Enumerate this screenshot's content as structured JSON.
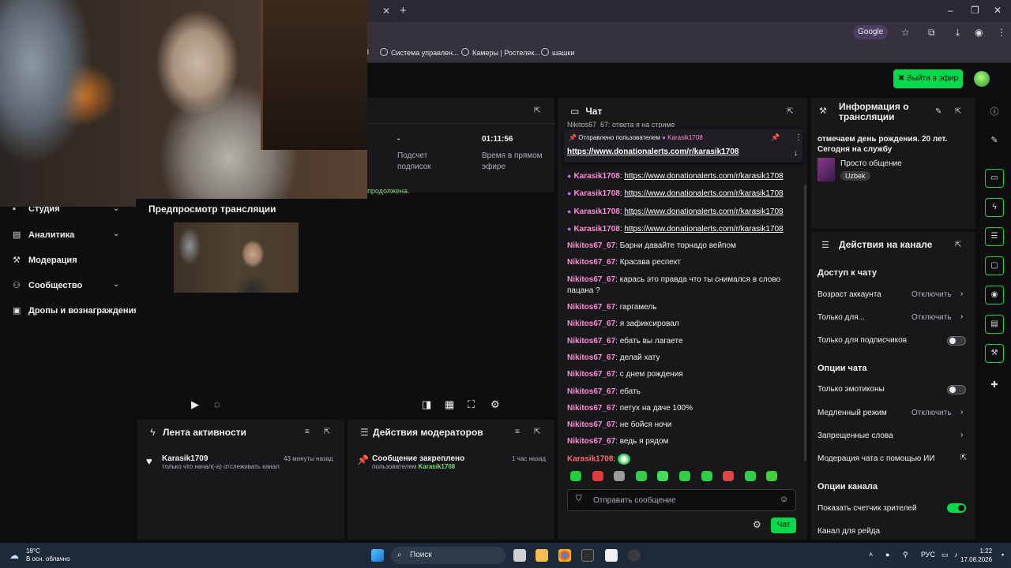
{
  "browser": {
    "bookmarks": [
      "8",
      "Система управлен...",
      "Камеры | Ростелек...",
      "шашки"
    ],
    "google_chip": "Google"
  },
  "topbar": {
    "go_live": "Выйти в эфир"
  },
  "leftnav": {
    "items": [
      {
        "label": "Студия",
        "icon": "camera-icon",
        "has_chevron": true
      },
      {
        "label": "Аналитика",
        "icon": "chart-icon",
        "has_chevron": true
      },
      {
        "label": "Модерация",
        "icon": "wrench-icon",
        "has_chevron": false
      },
      {
        "label": "Сообщество",
        "icon": "people-icon",
        "has_chevron": true
      },
      {
        "label": "Дропы и вознаграждения",
        "icon": "gift-icon",
        "has_chevron": false
      }
    ]
  },
  "stats": {
    "subs_value": "-",
    "subs_label": "Подсчет подписок",
    "uptime_value": "01:11:56",
    "uptime_label": "Время в прямом эфире",
    "note": "продолжена."
  },
  "preview": {
    "title": "Предпросмотр трансляции"
  },
  "activity": {
    "title": "Лента активности",
    "events": [
      {
        "name": "Karasik1709",
        "sub": "только что начал(-а) отслеживать канал",
        "time": "43 минуты назад"
      }
    ]
  },
  "mod_actions": {
    "title": "Действия модераторов",
    "events": [
      {
        "name": "Сообщение закреплено",
        "sub_prefix": "пользователем",
        "sub_user": "Karasik1708",
        "time": "1 час назад"
      }
    ]
  },
  "chat": {
    "title": "Чат",
    "cut_top": "Nikitos67_67: ответа я на стриме",
    "pinned_by_label": "Отправлено пользователем",
    "pinned_by_user": "Karasik1708",
    "pinned_link": "https://www.donationalerts.com/r/karasik1708",
    "messages": [
      {
        "user": "Karasik1708",
        "text": "https://www.donationalerts.com/r/karasik1708",
        "link": true,
        "mic": true
      },
      {
        "user": "Karasik1708",
        "text": "https://www.donationalerts.com/r/karasik1708",
        "link": true,
        "mic": true
      },
      {
        "user": "Karasik1708",
        "text": "https://www.donationalerts.com/r/karasik1708",
        "link": true,
        "mic": true
      },
      {
        "user": "Karasik1708",
        "text": "https://www.donationalerts.com/r/karasik1708",
        "link": true,
        "mic": true
      },
      {
        "user": "Nikitos67_67",
        "text": "Барни давайте торнадо вейпом"
      },
      {
        "user": "Nikitos67_67",
        "text": "Красава респект"
      },
      {
        "user": "Nikitos67_67",
        "text": "карась это правда что ты снимался в слово пацана ?"
      },
      {
        "user": "Nikitos67_67",
        "text": "гаргамель"
      },
      {
        "user": "Nikitos67_67",
        "text": "я зафиксировал"
      },
      {
        "user": "Nikitos67_67",
        "text": "ебать вы лагаете"
      },
      {
        "user": "Nikitos67_67",
        "text": "делай хату"
      },
      {
        "user": "Nikitos67_67",
        "text": "с днем рождения"
      },
      {
        "user": "Nikitos67_67",
        "text": "ебать"
      },
      {
        "user": "Nikitos67_67",
        "text": "петух на даче 100%"
      },
      {
        "user": "Nikitos67_67",
        "text": "не бойся ночи"
      },
      {
        "user": "Nikitos67_67",
        "text": "ведь я рядом"
      },
      {
        "user": "Karasik1708",
        "text": "",
        "emote": true
      }
    ],
    "input_placeholder": "Отправить сообщение",
    "send_label": "Чат"
  },
  "info": {
    "title": "Информация о трансляции",
    "stream_title": "отмечаем день рождения. 20 лет. Сегодня на службу",
    "category": "Просто общение",
    "tag": "Uzbek"
  },
  "channel_actions": {
    "title": "Действия на канале",
    "chat_access_title": "Доступ к чату",
    "account_age_label": "Возраст аккаунта",
    "account_age_value": "Отключить",
    "followers_only_label": "Только для...",
    "followers_only_value": "Отключить",
    "subs_only_label": "Только для подписчиков",
    "chat_options_title": "Опции чата",
    "emote_only_label": "Только эмотиконы",
    "slow_mode_label": "Медленный режим",
    "slow_mode_value": "Отключить",
    "banned_words_label": "Запрещенные слова",
    "ai_mod_label": "Модерация чата с помощью ИИ",
    "channel_options_title": "Опции канала",
    "viewer_count_label": "Показать счетчик зрителей",
    "raid_label": "Канал для рейда"
  },
  "taskbar": {
    "temp": "18°C",
    "weather": "В осн. облачно",
    "search": "Поиск",
    "lang": "РУС",
    "time": "1:22",
    "date": "17.08.2026"
  },
  "colors": {
    "accent": "#00db4a",
    "chat_user": "#ff8bd6",
    "chat_user_alt": "#ff6b6b"
  }
}
